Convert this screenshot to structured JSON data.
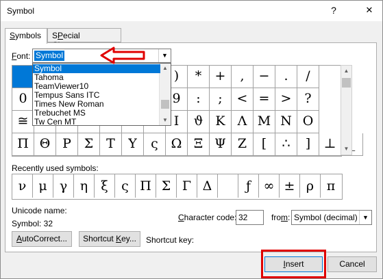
{
  "window": {
    "title": "Symbol",
    "help_glyph": "?",
    "close_glyph": "✕"
  },
  "tabs": [
    {
      "label": "Symbols",
      "accel": "S",
      "rest": "ymbols"
    },
    {
      "label": "Special Characters",
      "accel": "P",
      "pre": "",
      "rest": "ecial Characters",
      "prefix": "S"
    }
  ],
  "font": {
    "label_accel": "F",
    "label_rest": "ont:",
    "value": "Symbol"
  },
  "font_list": [
    "Symbol",
    "Tahoma",
    "TeamViewer10",
    "Tempus Sans ITC",
    "Times New Roman",
    "Trebuchet MS",
    "Tw Cen MT"
  ],
  "grid": [
    [
      "",
      "",
      "",
      "",
      "",
      "",
      "(",
      ")",
      "*",
      "+",
      ",",
      "−",
      ".",
      "/"
    ],
    [
      "0",
      "",
      "",
      "",
      "",
      "",
      "8",
      "9",
      ":",
      ";",
      "<",
      "=",
      ">",
      "?"
    ],
    [
      "≅",
      "Α",
      "Β",
      "Χ",
      "Δ",
      "Ε",
      "Η",
      "Ι",
      "ϑ",
      "Κ",
      "Λ",
      "Μ",
      "Ν",
      "Ο"
    ],
    [
      "Π",
      "Θ",
      "Ρ",
      "Σ",
      "Τ",
      "Υ",
      "ς",
      "Ω",
      "Ξ",
      "Ψ",
      "Ζ",
      "[",
      "∴",
      "]",
      "⊥",
      "_"
    ]
  ],
  "recent_label": "Recently used symbols:",
  "recent": [
    "ν",
    "μ",
    "γ",
    "η",
    "ξ",
    "ς",
    "Π",
    "Σ",
    "Γ",
    "Δ",
    "",
    "ƒ",
    "∞",
    "±",
    "ρ",
    "π"
  ],
  "unicode_name_label": "Unicode name:",
  "symbol_info": "Symbol: 32",
  "char_code": {
    "label_pre": "",
    "accel": "C",
    "label_rest": "haracter code:",
    "value": "32"
  },
  "from": {
    "label_pre": "fro",
    "accel": "m",
    "label_rest": ":",
    "value": "Symbol (decimal)"
  },
  "buttons": {
    "autocorrect": {
      "accel": "A",
      "rest": "utoCorrect..."
    },
    "shortcut_key": {
      "pre": "Shortcut ",
      "accel": "K",
      "rest": "ey..."
    },
    "insert": {
      "accel": "I",
      "rest": "nsert"
    },
    "cancel": "Cancel"
  },
  "shortcut_key_label": "Shortcut key:"
}
